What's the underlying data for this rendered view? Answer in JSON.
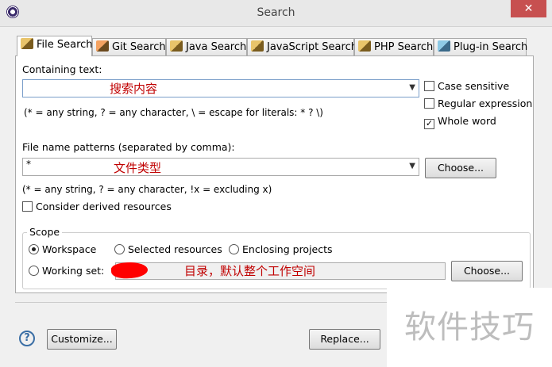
{
  "window": {
    "title": "Search",
    "close_glyph": "✕"
  },
  "tabs": [
    {
      "label": "File Search",
      "icon": "file-search-icon",
      "active": true
    },
    {
      "label": "Git Search",
      "icon": "git-search-icon"
    },
    {
      "label": "Java Search",
      "icon": "java-search-icon"
    },
    {
      "label": "JavaScript Search",
      "icon": "javascript-search-icon"
    },
    {
      "label": "PHP Search",
      "icon": "php-search-icon"
    },
    {
      "label": "Plug-in Search",
      "icon": "plugin-search-icon"
    }
  ],
  "containing_text": {
    "label": "Containing text:",
    "value": "",
    "annotation": "搜索内容",
    "hint": "(* = any string, ? = any character, \\ = escape for literals: * ? \\)"
  },
  "options": {
    "case_sensitive": {
      "label": "Case sensitive",
      "checked": false
    },
    "regular_expression": {
      "label": "Regular expression",
      "checked": false
    },
    "whole_word": {
      "label": "Whole word",
      "checked": true
    }
  },
  "file_patterns": {
    "label": "File name patterns (separated by comma):",
    "value": "*",
    "annotation": "文件类型",
    "hint": "(* = any string, ? = any character, !x = excluding x)",
    "choose_label": "Choose..."
  },
  "derived": {
    "label": "Consider derived resources",
    "checked": false
  },
  "scope": {
    "title": "Scope",
    "workspace": {
      "label": "Workspace",
      "selected": true
    },
    "selected_resources": {
      "label": "Selected resources",
      "selected": false
    },
    "enclosing_projects": {
      "label": "Enclosing projects",
      "selected": false
    },
    "working_set": {
      "label": "Working set:",
      "selected": false,
      "value": ""
    },
    "annotation": "目录，默认整个工作空间",
    "choose_label": "Choose..."
  },
  "footer": {
    "help": "?",
    "customize_label": "Customize...",
    "replace_label": "Replace..."
  },
  "watermark": "软件技巧",
  "colors": {
    "annotation": "#c00000",
    "close": "#c75050",
    "redaction": "#ff0000"
  }
}
